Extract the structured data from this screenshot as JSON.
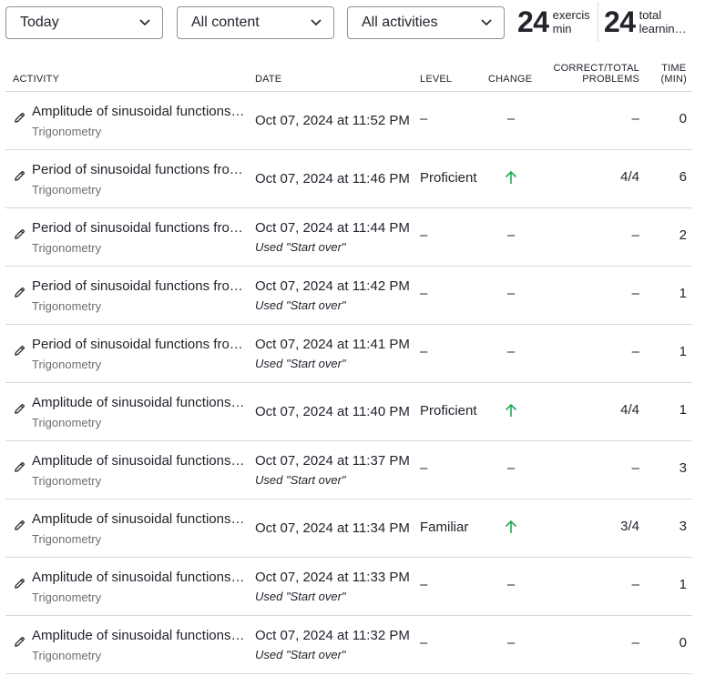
{
  "filters": {
    "date_range": "Today",
    "content": "All content",
    "activity": "All activities"
  },
  "stats": {
    "exercise": {
      "value": "24",
      "label_1": "exercise",
      "label_2": "min"
    },
    "total": {
      "value": "24",
      "label_1": "total",
      "label_2": "learning..."
    }
  },
  "table": {
    "headers": {
      "activity": "Activity",
      "date": "Date",
      "level": "Level",
      "change": "Change",
      "ctp_1": "Correct/Total",
      "ctp_2": "Problems",
      "time_1": "Time",
      "time_2": "(min)"
    },
    "rows": [
      {
        "title": "Amplitude of sinusoidal functions from equation",
        "subject": "Trigonometry",
        "date": "Oct 07, 2024 at 11:52 PM",
        "note": "",
        "level": "–",
        "change": "–",
        "ctp": "–",
        "time": "0"
      },
      {
        "title": "Period of sinusoidal functions from equation",
        "subject": "Trigonometry",
        "date": "Oct 07, 2024 at 11:46 PM",
        "note": "",
        "level": "Proficient",
        "change": "up",
        "ctp": "4/4",
        "time": "6"
      },
      {
        "title": "Period of sinusoidal functions from equation",
        "subject": "Trigonometry",
        "date": "Oct 07, 2024 at 11:44 PM",
        "note": "Used \"Start over\"",
        "level": "–",
        "change": "–",
        "ctp": "–",
        "time": "2"
      },
      {
        "title": "Period of sinusoidal functions from equation",
        "subject": "Trigonometry",
        "date": "Oct 07, 2024 at 11:42 PM",
        "note": "Used \"Start over\"",
        "level": "–",
        "change": "–",
        "ctp": "–",
        "time": "1"
      },
      {
        "title": "Period of sinusoidal functions from equation",
        "subject": "Trigonometry",
        "date": "Oct 07, 2024 at 11:41 PM",
        "note": "Used \"Start over\"",
        "level": "–",
        "change": "–",
        "ctp": "–",
        "time": "1"
      },
      {
        "title": "Amplitude of sinusoidal functions from equation",
        "subject": "Trigonometry",
        "date": "Oct 07, 2024 at 11:40 PM",
        "note": "",
        "level": "Proficient",
        "change": "up",
        "ctp": "4/4",
        "time": "1"
      },
      {
        "title": "Amplitude of sinusoidal functions from equation",
        "subject": "Trigonometry",
        "date": "Oct 07, 2024 at 11:37 PM",
        "note": "Used \"Start over\"",
        "level": "–",
        "change": "–",
        "ctp": "–",
        "time": "3"
      },
      {
        "title": "Amplitude of sinusoidal functions from equation",
        "subject": "Trigonometry",
        "date": "Oct 07, 2024 at 11:34 PM",
        "note": "",
        "level": "Familiar",
        "change": "up",
        "ctp": "3/4",
        "time": "3"
      },
      {
        "title": "Amplitude of sinusoidal functions from equation",
        "subject": "Trigonometry",
        "date": "Oct 07, 2024 at 11:33 PM",
        "note": "Used \"Start over\"",
        "level": "–",
        "change": "–",
        "ctp": "–",
        "time": "1"
      },
      {
        "title": "Amplitude of sinusoidal functions from equation",
        "subject": "Trigonometry",
        "date": "Oct 07, 2024 at 11:32 PM",
        "note": "Used \"Start over\"",
        "level": "–",
        "change": "–",
        "ctp": "–",
        "time": "0"
      }
    ]
  },
  "colors": {
    "text": "#21242c",
    "muted": "#6b6d72",
    "border": "#d6d8da",
    "up_arrow": "#1fab54"
  },
  "icons": {
    "row": "pencil-icon",
    "dropdown": "chevron-down-icon",
    "change_up": "arrow-up-icon"
  }
}
